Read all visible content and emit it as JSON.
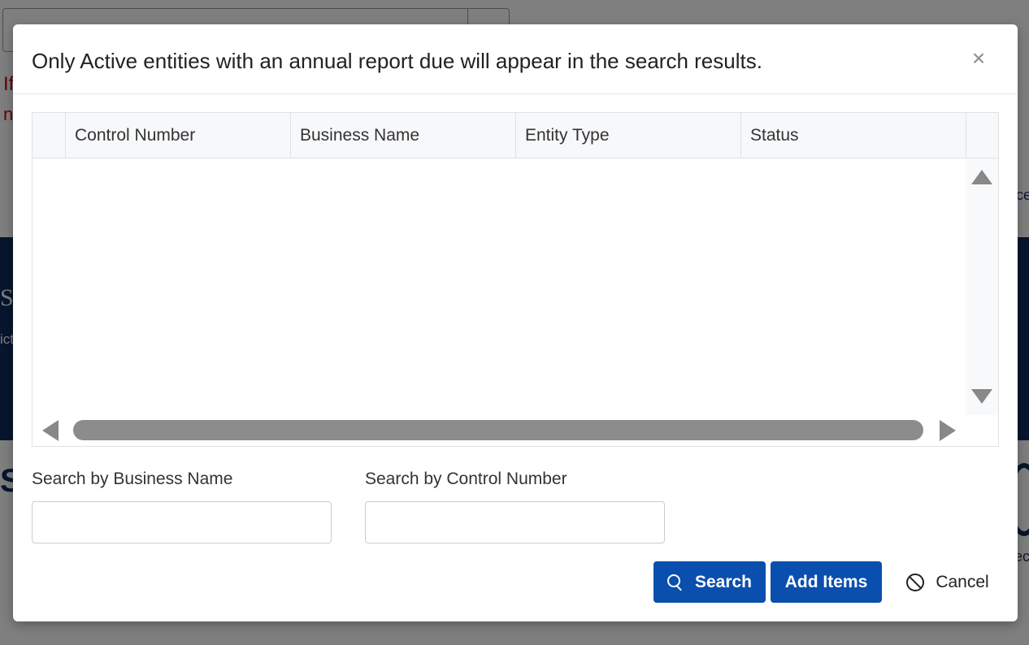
{
  "background": {
    "red_line_1": "If",
    "red_line_2": "n",
    "band_heading": "ST",
    "band_sub": "ict",
    "right_fragment_1": "ce",
    "right_fragment_2": "ec",
    "left_logo_text": "S"
  },
  "modal": {
    "title": "Only Active entities with an annual report due will appear in the search results.",
    "close_label": "×"
  },
  "grid": {
    "columns": [
      "",
      "Control Number",
      "Business Name",
      "Entity Type",
      "Status",
      ""
    ],
    "rows": []
  },
  "search": {
    "business_name_label": "Search by Business Name",
    "business_name_value": "",
    "control_number_label": "Search by Control Number",
    "control_number_value": ""
  },
  "buttons": {
    "search_label": "Search",
    "add_items_label": "Add Items",
    "cancel_label": "Cancel"
  },
  "colors": {
    "primary": "#0b4fae",
    "band": "#0f2b5c",
    "scroll_thumb": "#8c8c8c"
  }
}
